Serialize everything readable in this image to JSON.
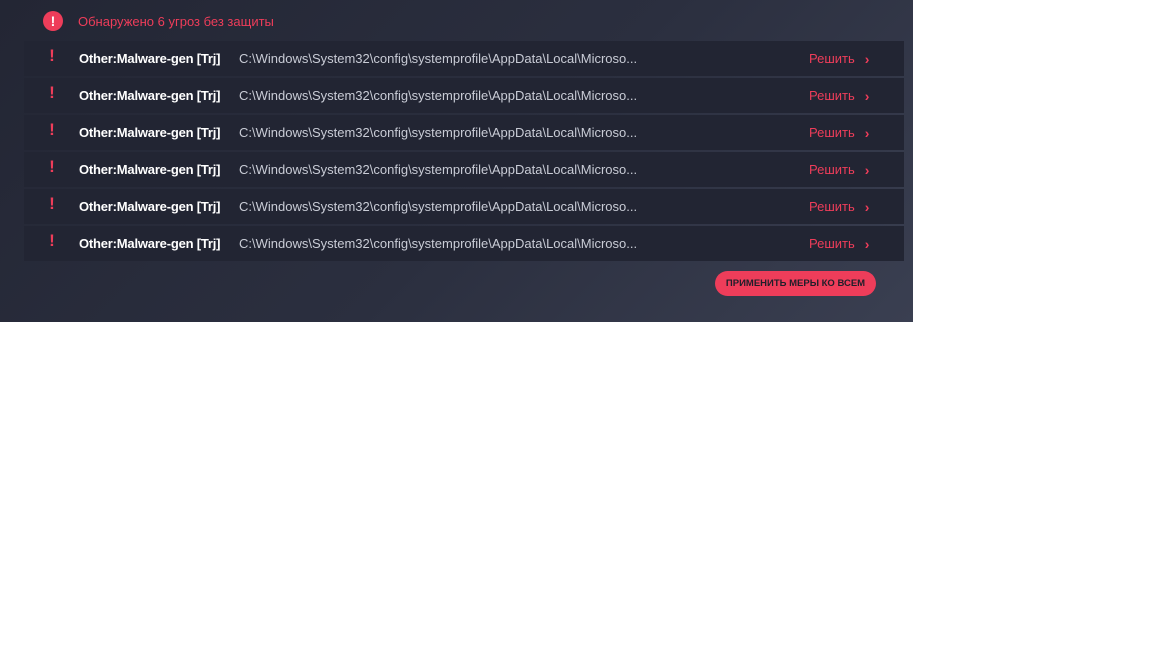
{
  "header": {
    "icon": "alert-circle-icon",
    "title": "Обнаружено 6 угроз без защиты"
  },
  "threats": [
    {
      "icon": "exclamation-icon",
      "name": "Other:Malware-gen [Trj]",
      "path": "C:\\Windows\\System32\\config\\systemprofile\\AppData\\Local\\Microso...",
      "action": "Решить",
      "action_icon": "chevron-right-icon"
    },
    {
      "icon": "exclamation-icon",
      "name": "Other:Malware-gen [Trj]",
      "path": "C:\\Windows\\System32\\config\\systemprofile\\AppData\\Local\\Microso...",
      "action": "Решить",
      "action_icon": "chevron-right-icon"
    },
    {
      "icon": "exclamation-icon",
      "name": "Other:Malware-gen [Trj]",
      "path": "C:\\Windows\\System32\\config\\systemprofile\\AppData\\Local\\Microso...",
      "action": "Решить",
      "action_icon": "chevron-right-icon"
    },
    {
      "icon": "exclamation-icon",
      "name": "Other:Malware-gen [Trj]",
      "path": "C:\\Windows\\System32\\config\\systemprofile\\AppData\\Local\\Microso...",
      "action": "Решить",
      "action_icon": "chevron-right-icon"
    },
    {
      "icon": "exclamation-icon",
      "name": "Other:Malware-gen [Trj]",
      "path": "C:\\Windows\\System32\\config\\systemprofile\\AppData\\Local\\Microso...",
      "action": "Решить",
      "action_icon": "chevron-right-icon"
    },
    {
      "icon": "exclamation-icon",
      "name": "Other:Malware-gen [Trj]",
      "path": "C:\\Windows\\System32\\config\\systemprofile\\AppData\\Local\\Microso...",
      "action": "Решить",
      "action_icon": "chevron-right-icon"
    }
  ],
  "apply_all_label": "ПРИМЕНИТЬ МЕРЫ КО ВСЕМ",
  "colors": {
    "accent": "#ee3d5a",
    "panel_background": "#2b2f3f",
    "row_background": "#222533",
    "path_text": "#c9ccd6"
  }
}
